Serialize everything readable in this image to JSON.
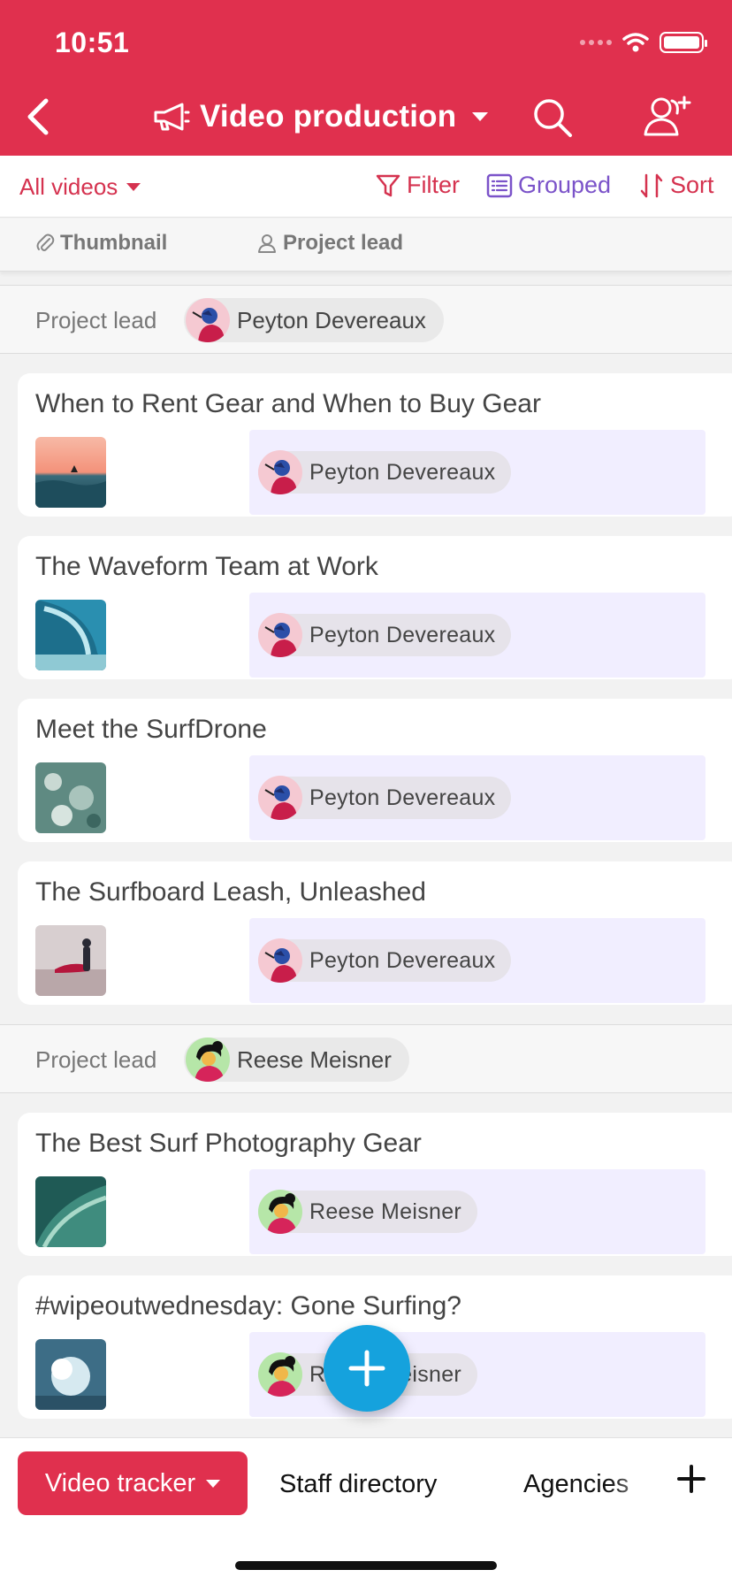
{
  "status_bar": {
    "time": "10:51"
  },
  "header": {
    "title": "Video production",
    "icons": [
      "chevron-left-icon",
      "megaphone-icon",
      "search-icon",
      "share-people-icon"
    ],
    "color": "#e0304e"
  },
  "toolbar": {
    "view_label": "All videos",
    "filter_label": "Filter",
    "grouped_label": "Grouped",
    "sort_label": "Sort"
  },
  "fields": {
    "thumbnail_label": "Thumbnail",
    "project_lead_label": "Project lead"
  },
  "groups": [
    {
      "label": "Project lead",
      "person": "Peyton Devereaux",
      "records": [
        {
          "title": "When to Rent Gear and When to Buy Gear",
          "lead": "Peyton Devereaux"
        },
        {
          "title": "The Waveform Team at Work",
          "lead": "Peyton Devereaux"
        },
        {
          "title": "Meet the SurfDrone",
          "lead": "Peyton Devereaux"
        },
        {
          "title": "The Surfboard Leash, Unleashed",
          "lead": "Peyton Devereaux"
        }
      ]
    },
    {
      "label": "Project lead",
      "person": "Reese Meisner",
      "records": [
        {
          "title": "The Best Surf Photography Gear",
          "lead": "Reese Meisner"
        },
        {
          "title": "#wipeoutwednesday: Gone Surfing?",
          "lead": "Reese Meisner"
        }
      ]
    }
  ],
  "bottom_tabs": {
    "active": "Video tracker",
    "tab2": "Staff directory",
    "tab3": "Agencies"
  },
  "colors": {
    "accent": "#e0304e",
    "grouped": "#7b53c9",
    "fab": "#15a2dd",
    "field_bg": "#f1eeff"
  }
}
